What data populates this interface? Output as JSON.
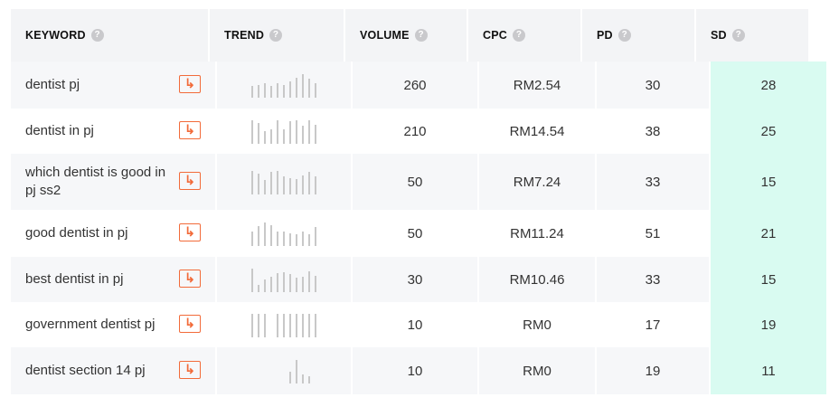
{
  "headers": {
    "keyword": "KEYWORD",
    "trend": "TREND",
    "volume": "VOLUME",
    "cpc": "CPC",
    "pd": "PD",
    "sd": "SD",
    "help_glyph": "?"
  },
  "goto_icon": "arrow-right-icon",
  "colors": {
    "accent_orange": "#f26b3a",
    "sd_highlight": "#d9fbf1",
    "row_alt": "#f6f7f9",
    "trend_bar": "#c8c8c8"
  },
  "rows": [
    {
      "keyword": "dentist pj",
      "volume": "260",
      "cpc": "RM2.54",
      "pd": "30",
      "sd": "28",
      "trend": [
        0.5,
        0.55,
        0.6,
        0.5,
        0.6,
        0.55,
        0.7,
        0.85,
        1.0,
        0.8,
        0.6
      ]
    },
    {
      "keyword": "dentist in pj",
      "volume": "210",
      "cpc": "RM14.54",
      "pd": "38",
      "sd": "25",
      "trend": [
        1.0,
        0.9,
        0.55,
        0.6,
        1.0,
        0.6,
        0.95,
        1.0,
        0.75,
        1.0,
        0.8
      ]
    },
    {
      "keyword": "which dentist is good in pj ss2",
      "volume": "50",
      "cpc": "RM7.24",
      "pd": "33",
      "sd": "15",
      "trend": [
        1.0,
        0.9,
        0.6,
        0.95,
        1.0,
        0.75,
        0.7,
        0.65,
        0.8,
        0.95,
        0.75
      ]
    },
    {
      "keyword": "good dentist in pj",
      "volume": "50",
      "cpc": "RM11.24",
      "pd": "51",
      "sd": "21",
      "trend": [
        0.6,
        0.85,
        1.0,
        0.9,
        0.6,
        0.6,
        0.55,
        0.5,
        0.6,
        0.5,
        0.8
      ]
    },
    {
      "keyword": "best dentist in pj",
      "volume": "30",
      "cpc": "RM10.46",
      "pd": "33",
      "sd": "15",
      "trend": [
        1.0,
        0.3,
        0.55,
        0.65,
        0.8,
        0.85,
        0.75,
        0.6,
        0.65,
        0.9,
        0.7
      ]
    },
    {
      "keyword": "government dentist pj",
      "volume": "10",
      "cpc": "RM0",
      "pd": "17",
      "sd": "19",
      "trend": [
        1.0,
        1.0,
        1.0,
        0,
        1.0,
        1.0,
        1.0,
        1.0,
        1.0,
        1.0,
        1.0
      ]
    },
    {
      "keyword": "dentist section 14 pj",
      "volume": "10",
      "cpc": "RM0",
      "pd": "19",
      "sd": "11",
      "trend": [
        0,
        0,
        0,
        0,
        0,
        0,
        0.5,
        1.0,
        0.4,
        0.3,
        0
      ]
    }
  ]
}
